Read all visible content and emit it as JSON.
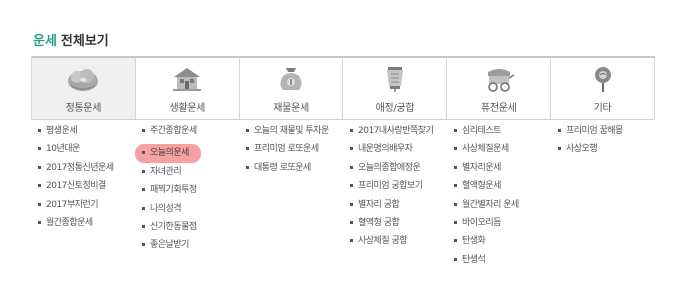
{
  "header": {
    "category": "운세",
    "all": "전체보기"
  },
  "tabs": [
    {
      "label": "정통운세",
      "icon": "cloud-icon",
      "active": true
    },
    {
      "label": "생활운세",
      "icon": "house-icon",
      "active": false
    },
    {
      "label": "재물운세",
      "icon": "money-bag-icon",
      "active": false
    },
    {
      "label": "애정/궁합",
      "icon": "lantern-icon",
      "active": false
    },
    {
      "label": "퓨전운세",
      "icon": "cart-icon",
      "active": false
    },
    {
      "label": "기타",
      "icon": "pin-icon",
      "active": false
    }
  ],
  "columns": [
    [
      "평생운세",
      "10년대운",
      "2017정통신년운세",
      "2017신토정비결",
      "2017부지런기",
      "월간종합운세"
    ],
    [
      "주간종합운세",
      "오늘의운세",
      "자녀관리",
      "패찍기회투정",
      "나의성격",
      "신기한동물점",
      "좋은날받기"
    ],
    [
      "오늘의 재물및 투자운",
      "프리미엄 로또운세",
      "대통령 로또운세"
    ],
    [
      "2017내사랑반쪽찾기",
      "내운명의배우자",
      "오늘의종합애정운",
      "프리미엄 궁합보기",
      "별자리 궁합",
      "혈액형 궁합",
      "사상체질 궁합"
    ],
    [
      "심리테스트",
      "사상체질운세",
      "별자리운세",
      "혈액형운세",
      "월간별자리 운세",
      "바이오리듬",
      "탄생화",
      "탄생석"
    ],
    [
      "프리미엄 꿈해몽",
      "사상오행"
    ]
  ],
  "highlight": {
    "column": 1,
    "item": 1
  }
}
